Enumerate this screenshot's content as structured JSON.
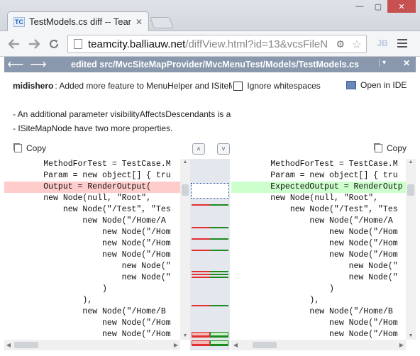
{
  "browser": {
    "tab_title": "TestModels.cs diff -- Tean",
    "tab_close": "✕",
    "favicon_text": "TC",
    "url_host": "teamcity.balliauw.net",
    "url_path": "/diffView.html?id=13&vcsFileN",
    "window": {
      "minimize": "—",
      "maximize": "▢",
      "close": "✕"
    },
    "ext_label": "JB"
  },
  "diff": {
    "title": "edited src/MvcSiteMapProvider/MvcMenuTest/Models/TestModels.cs",
    "prev_arrow": "⟵",
    "next_arrow": "⟶",
    "dropdown_arrow": "▾",
    "close": "✕",
    "author": "midishero",
    "commit_message": ": Added more feature to MenuHelper and ISiteM",
    "ignore_whitespace_label": "Ignore whitespaces",
    "open_in_ide_label": "Open in IDE",
    "description": [
      "- An additional parameter visibilityAffectsDescendants is a",
      "- ISiteMapNode have two more properties."
    ],
    "copy_label": "Copy",
    "prev_change": "˄",
    "next_change": "˅"
  },
  "code": {
    "left": [
      "        MethodForTest = TestCase.M",
      "        Param = new object[] { tru",
      "        Output = RenderOutput(",
      "        new Node(null, \"Root\",",
      "            new Node(\"/Test\", \"Tes",
      "                new Node(\"/Home/A",
      "                    new Node(\"/Hom",
      "                    new Node(\"/Hom",
      "                    new Node(\"/Hom",
      "                        new Node(\"",
      "                        new Node(\"",
      "                    )",
      "                ),",
      "                new Node(\"/Home/B",
      "                    new Node(\"/Hom",
      "                    new Node(\"/Hom"
    ],
    "right": [
      "        MethodForTest = TestCase.M",
      "        Param = new object[] { tru",
      "        ExpectedOutput = RenderOutp",
      "        new Node(null, \"Root\",",
      "            new Node(\"/Test\", \"Tes",
      "                new Node(\"/Home/A",
      "                    new Node(\"/Hom",
      "                    new Node(\"/Hom",
      "                    new Node(\"/Hom",
      "                        new Node(\"",
      "                        new Node(\"",
      "                    )",
      "                ),",
      "                new Node(\"/Home/B",
      "                    new Node(\"/Hom",
      "                    new Node(\"/Hom"
    ],
    "changed_line_index": 2
  },
  "colors": {
    "removed": "#ffcccc",
    "added": "#ccffcc",
    "header_bar": "#8a98ad",
    "gutter_red": "#e03030",
    "gutter_green": "#1e8a1e"
  }
}
